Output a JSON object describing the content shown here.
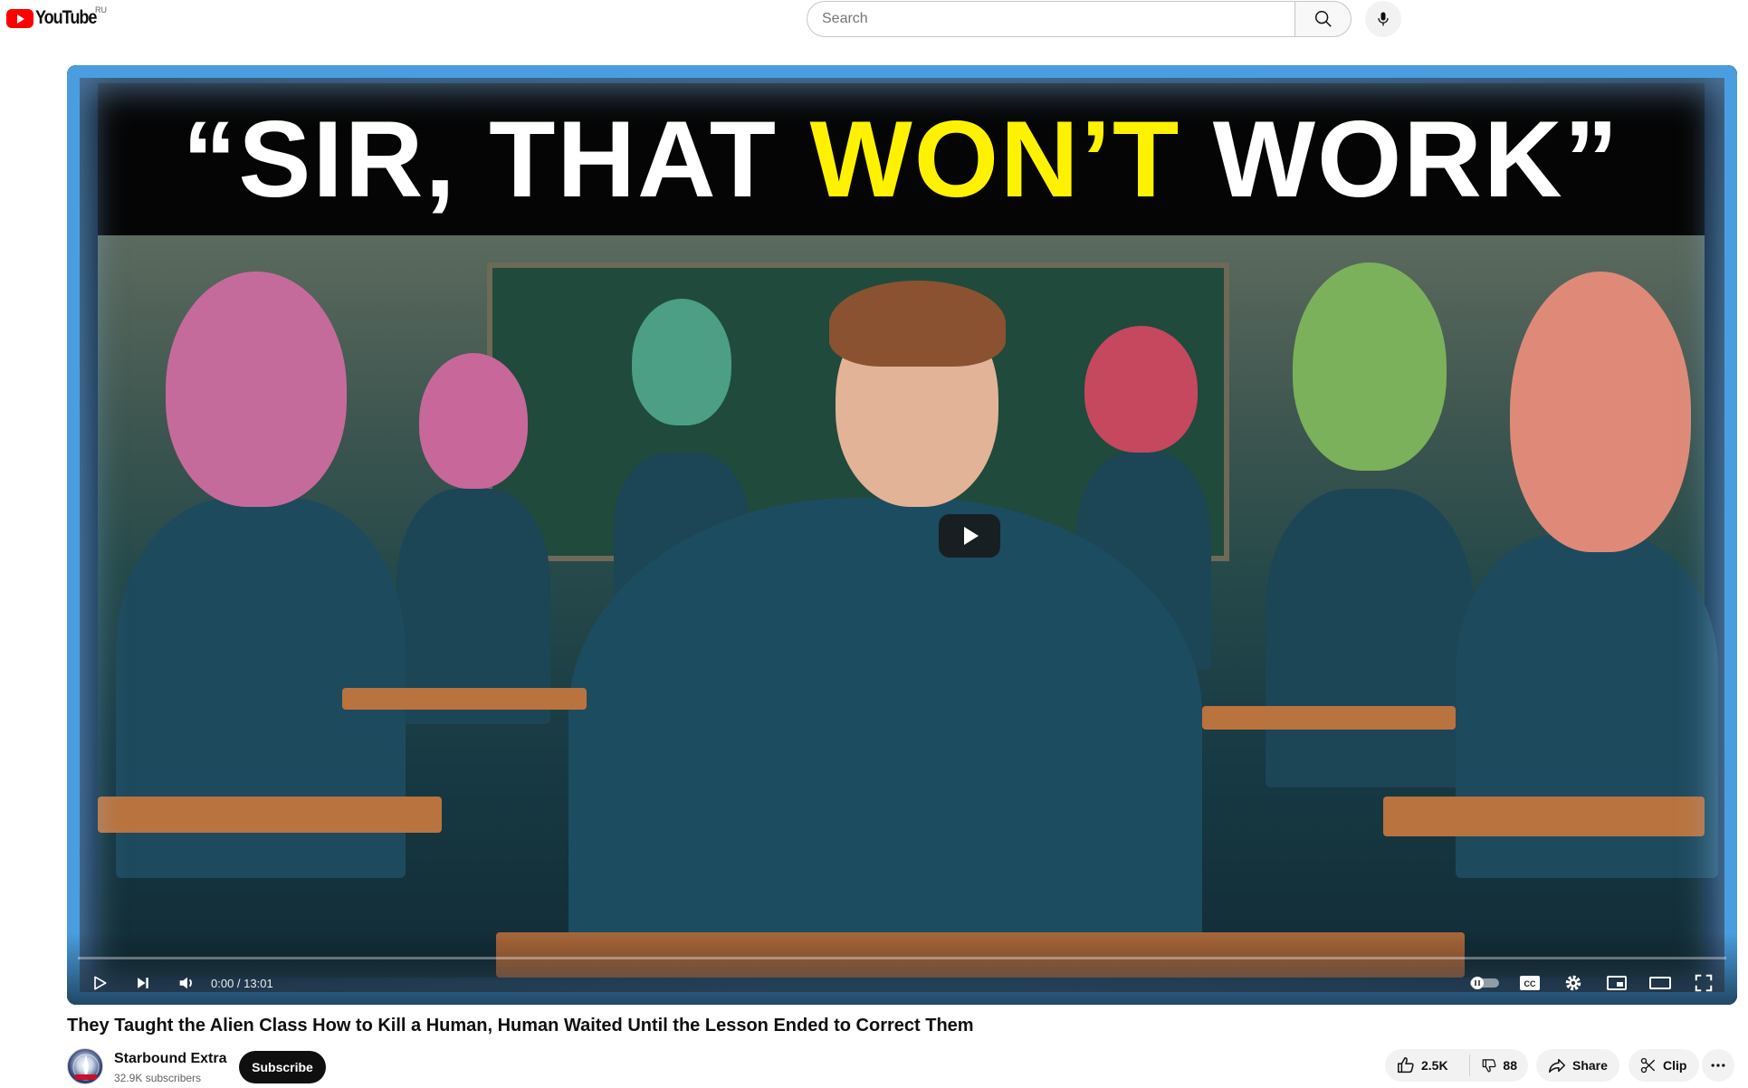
{
  "header": {
    "logo_text": "YouTube",
    "region": "RU",
    "search_placeholder": "Search"
  },
  "player": {
    "thumbnail_headline_pre": "“SIR, THAT ",
    "thumbnail_headline_highlight": "WON’T",
    "thumbnail_headline_post": " WORK”",
    "current_time": "0:00",
    "duration": "13:01",
    "time_display": "0:00 / 13:01",
    "progress_fraction": 0
  },
  "video": {
    "title": "They Taught the Alien Class How to Kill a Human, Human Waited Until the Lesson Ended to Correct Them"
  },
  "channel": {
    "name": "Starbound Extra",
    "subscribers": "32.9K subscribers",
    "subscribe_label": "Subscribe"
  },
  "actions": {
    "likes": "2.5K",
    "dislikes": "88",
    "share_label": "Share",
    "clip_label": "Clip"
  },
  "colors": {
    "brand_red": "#ff0000",
    "headline_highlight": "#fff200",
    "frame_blue": "#4a9ee0"
  }
}
